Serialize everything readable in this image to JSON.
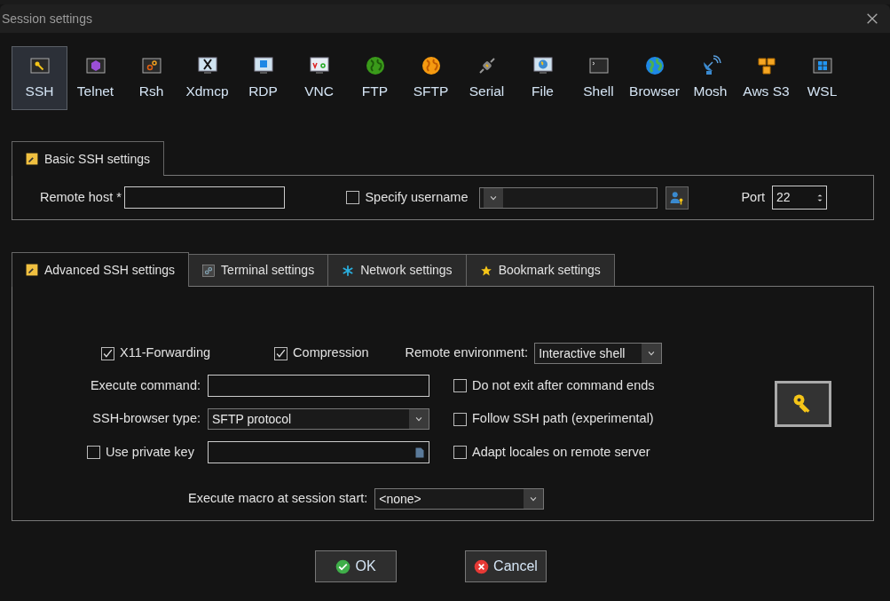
{
  "window": {
    "title": "Session settings"
  },
  "session_types": [
    {
      "label": "SSH",
      "selected": true
    },
    {
      "label": "Telnet",
      "selected": false
    },
    {
      "label": "Rsh",
      "selected": false
    },
    {
      "label": "Xdmcp",
      "selected": false
    },
    {
      "label": "RDP",
      "selected": false
    },
    {
      "label": "VNC",
      "selected": false
    },
    {
      "label": "FTP",
      "selected": false
    },
    {
      "label": "SFTP",
      "selected": false
    },
    {
      "label": "Serial",
      "selected": false
    },
    {
      "label": "File",
      "selected": false
    },
    {
      "label": "Shell",
      "selected": false
    },
    {
      "label": "Browser",
      "selected": false
    },
    {
      "label": "Mosh",
      "selected": false
    },
    {
      "label": "Aws S3",
      "selected": false
    },
    {
      "label": "WSL",
      "selected": false
    }
  ],
  "basic_tab": {
    "label": "Basic SSH settings",
    "selected": true
  },
  "basic": {
    "remote_host": {
      "label": "Remote host *"
    },
    "specify_username": {
      "label": "Specify username",
      "checked": false
    },
    "port": {
      "label": "Port",
      "value": "22"
    }
  },
  "advanced_tabs": [
    {
      "label": "Advanced SSH settings",
      "selected": true
    },
    {
      "label": "Terminal settings",
      "selected": false
    },
    {
      "label": "Network settings",
      "selected": false
    },
    {
      "label": "Bookmark settings",
      "selected": false
    }
  ],
  "advanced": {
    "x11_forwarding": {
      "label": "X11-Forwarding",
      "checked": true
    },
    "compression": {
      "label": "Compression",
      "checked": true
    },
    "remote_environment": {
      "label": "Remote environment:",
      "value": "Interactive shell"
    },
    "execute_command": {
      "label": "Execute command:"
    },
    "ssh_browser_type": {
      "label": "SSH-browser type:",
      "value": "SFTP protocol"
    },
    "use_private_key": {
      "label": "Use private key",
      "checked": false
    },
    "options": [
      {
        "label": "Do not exit after command ends",
        "checked": false
      },
      {
        "label": "Follow SSH path (experimental)",
        "checked": false
      },
      {
        "label": "Adapt locales on remote server",
        "checked": false
      }
    ],
    "macro": {
      "label": "Execute macro at session start:",
      "value": "<none>"
    }
  },
  "buttons": [
    {
      "label": "OK",
      "kind": "ok"
    },
    {
      "label": "Cancel",
      "kind": "cancel"
    }
  ]
}
